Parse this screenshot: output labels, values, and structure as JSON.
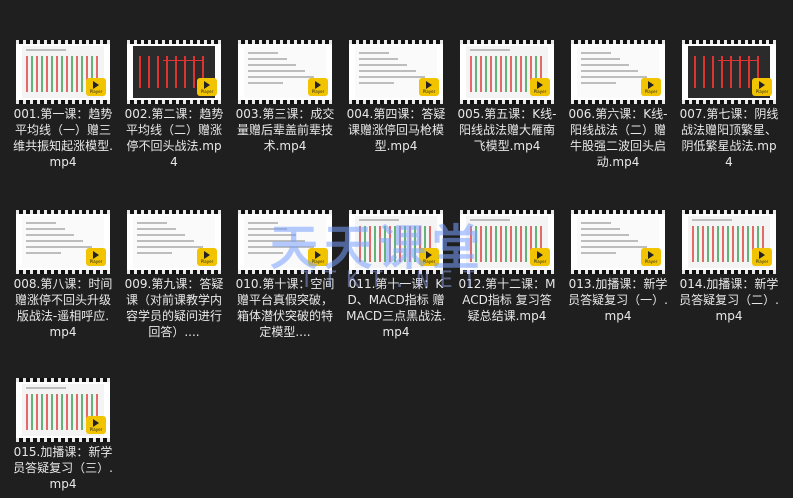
{
  "files": [
    {
      "name": "001.第一课：趋势平均线（一）赠三维共振知起涨模型.mp4",
      "thumb": "chart"
    },
    {
      "name": "002.第二课：趋势平均线（二）赠涨停不回头战法.mp4",
      "thumb": "dark"
    },
    {
      "name": "003.第三课：成交量赠后辈盖前辈技术.mp4",
      "thumb": "doc"
    },
    {
      "name": "004.第四课：答疑课赠涨停回马枪模型.mp4",
      "thumb": "doc"
    },
    {
      "name": "005.第五课：K线-阳线战法赠大雁南飞模型.mp4",
      "thumb": "chart"
    },
    {
      "name": "006.第六课：K线-阳线战法（二）赠牛股强二波回头启动.mp4",
      "thumb": "doc"
    },
    {
      "name": "007.第七课：阴线战法赠阳顶繁星、阴低繁星战法.mp4",
      "thumb": "dark"
    },
    {
      "name": "008.第八课：时间赠涨停不回头升级版战法-遥相呼应.mp4",
      "thumb": "doc"
    },
    {
      "name": "009.第九课：答疑课（对前课教学内容学员的疑问进行回答）....",
      "thumb": "doc"
    },
    {
      "name": "010.第十课：空间 赠平台真假突破，箱体潜伏突破的特定模型....",
      "thumb": "doc"
    },
    {
      "name": "011.第十一课：KD、MACD指标 赠MACD三点黑战法.mp4",
      "thumb": "chart"
    },
    {
      "name": "012.第十二课：MACD指标 复习答疑总结课.mp4",
      "thumb": "chart"
    },
    {
      "name": "013.加播课：新学员答疑复习（一）.mp4",
      "thumb": "doc"
    },
    {
      "name": "014.加播课：新学员答疑复习（二）.mp4",
      "thumb": "chart"
    },
    {
      "name": "015.加播课：新学员答疑复习（三）.mp4",
      "thumb": "chart"
    }
  ],
  "badge": {
    "label": "Player",
    "color": "#f2c400"
  },
  "watermark": {
    "main": "天天课堂",
    "sub": "TTKT.NET"
  }
}
